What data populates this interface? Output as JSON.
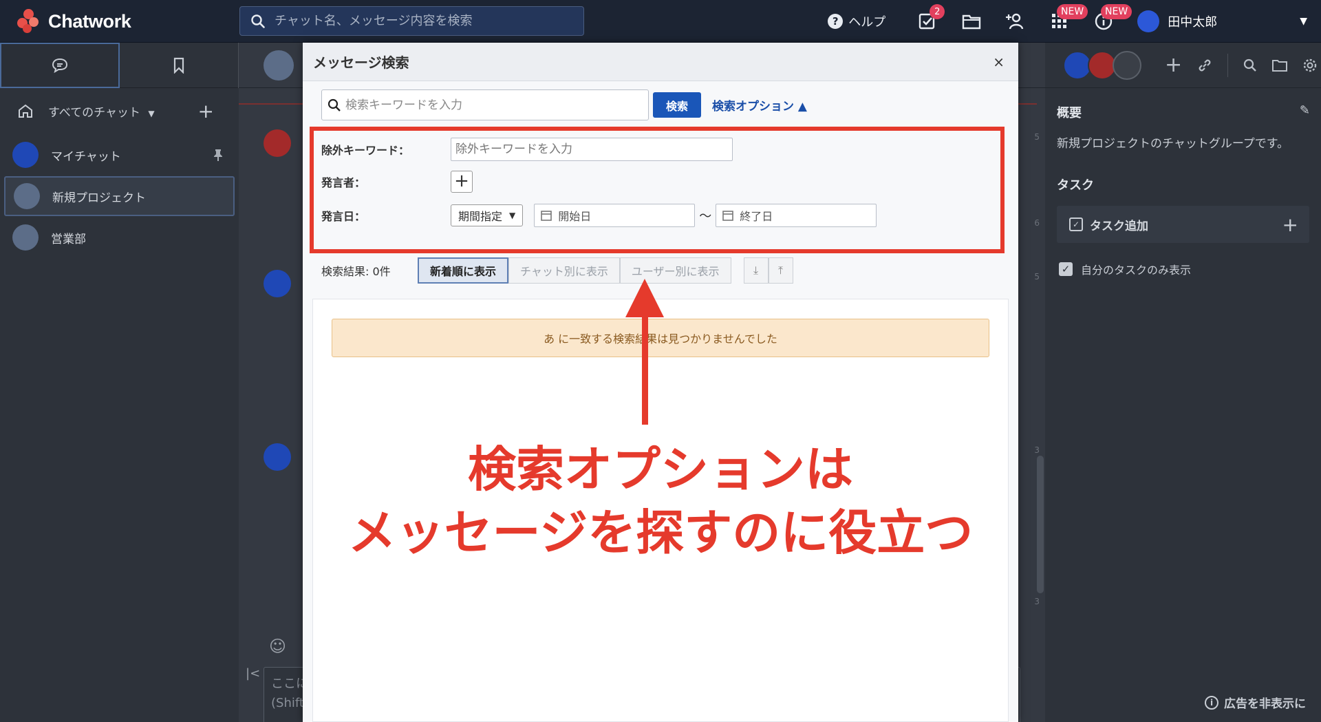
{
  "app": {
    "logo_text": "Chatwork",
    "search_placeholder": "チャット名、メッセージ内容を検索",
    "help_label": "ヘルプ",
    "task_badge": "2",
    "apps_badge": "NEW",
    "info_badge": "NEW",
    "user_name": "田中太郎"
  },
  "sidebar": {
    "filter_label": "すべてのチャット",
    "rooms": [
      {
        "label": "マイチャット",
        "color": "#1f48b6"
      },
      {
        "label": "新規プロジェクト",
        "color": "#5c6d88"
      },
      {
        "label": "営業部",
        "color": "#5c6d88"
      }
    ]
  },
  "chat": {
    "input_lines": [
      "ここに",
      "(Shift"
    ],
    "time_marks": [
      "5",
      "6",
      "5",
      "3",
      "3"
    ]
  },
  "right_panel": {
    "overview_title": "概要",
    "overview_text": "新規プロジェクトのチャットグループです。",
    "task_title": "タスク",
    "task_add_label": "タスク追加",
    "own_tasks_label": "自分のタスクのみ表示",
    "hide_ad_label": "広告を非表示に"
  },
  "modal": {
    "title": "メッセージ検索",
    "close_symbol": "×",
    "keyword_placeholder": "検索キーワードを入力",
    "search_button": "検索",
    "options_toggle": "検索オプション ▲",
    "exclude_label": "除外キーワード：",
    "exclude_placeholder": "除外キーワードを入力",
    "speaker_label": "発言者：",
    "date_label": "発言日：",
    "period_label": "期間指定",
    "start_date": "開始日",
    "end_date": "終了日",
    "tilde": "〜",
    "results_count": "検索結果: 0件",
    "views": [
      "新着順に表示",
      "チャット別に表示",
      "ユーザー別に表示"
    ],
    "no_result_message": "あ に一致する検索結果は見つかりませんでした"
  },
  "annotation": {
    "line1": "検索オプションは",
    "line2": "メッセージを探すのに役立つ",
    "color": "#e53a2c"
  },
  "colors": {
    "brand_red": "#e8504a",
    "accent_blue": "#1a56b8",
    "topbar": "#1c2433"
  }
}
